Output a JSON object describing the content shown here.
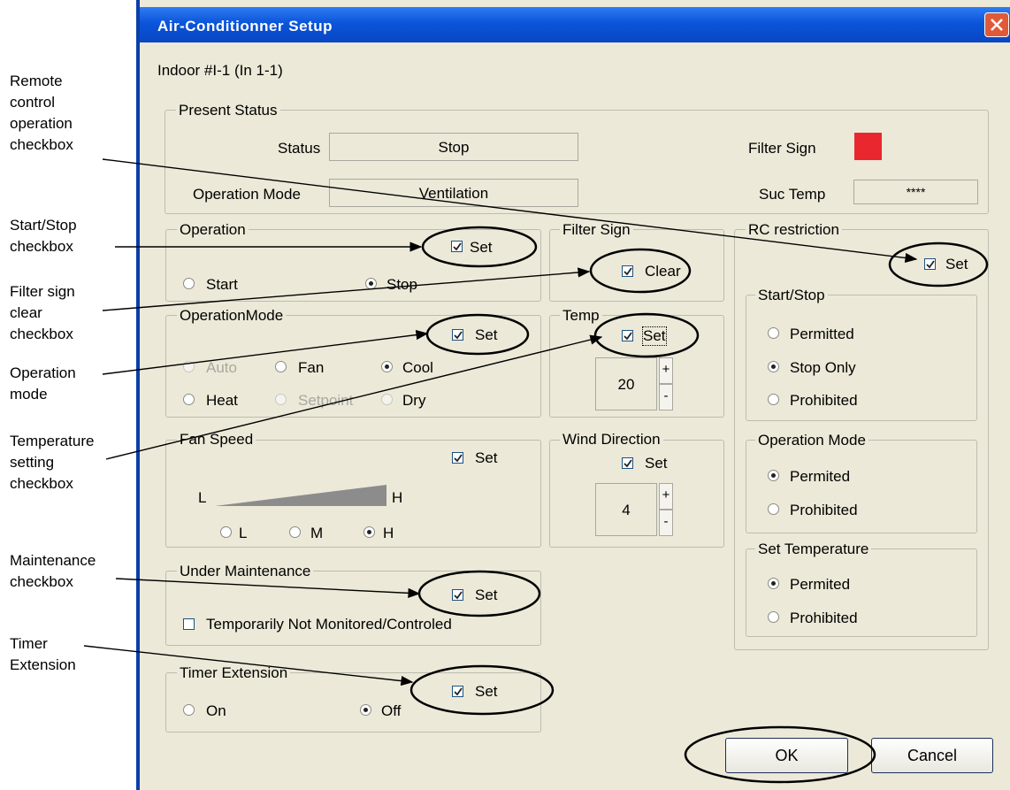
{
  "window": {
    "title": "Air-Conditionner Setup",
    "indoor_label": "Indoor #I-1  (In 1-1)"
  },
  "present_status": {
    "legend": "Present Status",
    "status_label": "Status",
    "status_value": "Stop",
    "mode_label": "Operation Mode",
    "mode_value": "Ventilation",
    "filter_label": "Filter Sign",
    "filter_color": "#e8282e",
    "suc_label": "Suc Temp",
    "suc_value": "****"
  },
  "operation": {
    "legend": "Operation",
    "set_label": "Set",
    "start": "Start",
    "stop": "Stop",
    "selected": "Stop"
  },
  "filter_sign": {
    "legend": "Filter Sign",
    "clear_label": "Clear"
  },
  "operation_mode": {
    "legend": "OperationMode",
    "set_label": "Set",
    "auto": "Auto",
    "fan": "Fan",
    "cool": "Cool",
    "heat": "Heat",
    "setpoint": "Setpoint",
    "dry": "Dry",
    "selected": "Cool"
  },
  "temp": {
    "legend": "Temp",
    "set_label": "Set",
    "value": "20",
    "plus": "+",
    "minus": "-"
  },
  "fan_speed": {
    "legend": "Fan Speed",
    "set_label": "Set",
    "low": "L",
    "high": "H",
    "opt_l": "L",
    "opt_m": "M",
    "opt_h": "H",
    "selected": "H"
  },
  "wind_direction": {
    "legend": "Wind Direction",
    "set_label": "Set",
    "value": "4",
    "plus": "+",
    "minus": "-"
  },
  "maintenance": {
    "legend": "Under Maintenance",
    "set_label": "Set",
    "not_monitored": "Temporarily Not Monitored/Controled"
  },
  "timer": {
    "legend": "Timer Extension",
    "set_label": "Set",
    "on": "On",
    "off": "Off",
    "selected": "Off"
  },
  "rc_restriction": {
    "legend": "RC restriction",
    "set_label": "Set",
    "start_stop": {
      "legend": "Start/Stop",
      "permitted": "Permitted",
      "stop_only": "Stop Only",
      "prohibited": "Prohibited",
      "selected": "Stop Only"
    },
    "operation_mode": {
      "legend": "Operation Mode",
      "permited": "Permited",
      "prohibited": "Prohibited",
      "selected": "Permited"
    },
    "set_temperature": {
      "legend": "Set Temperature",
      "permited": "Permited",
      "prohibited": "Prohibited",
      "selected": "Permited"
    }
  },
  "buttons": {
    "ok": "OK",
    "cancel": "Cancel"
  },
  "annotations": {
    "remote_control": [
      "Remote",
      "control",
      "operation",
      "checkbox"
    ],
    "start_stop": [
      "Start/Stop",
      "checkbox"
    ],
    "filter_sign": [
      "Filter sign",
      "clear",
      "checkbox"
    ],
    "operation_mode": [
      "Operation",
      "mode"
    ],
    "temperature": [
      "Temperature",
      "setting",
      "checkbox"
    ],
    "maintenance": [
      "Maintenance",
      "checkbox"
    ],
    "timer": [
      "Timer",
      "Extension"
    ]
  },
  "colors": {
    "title_bar": "#0a55d9",
    "dialog_bg": "#ece9d8",
    "filter_sign": "#e8282e"
  }
}
